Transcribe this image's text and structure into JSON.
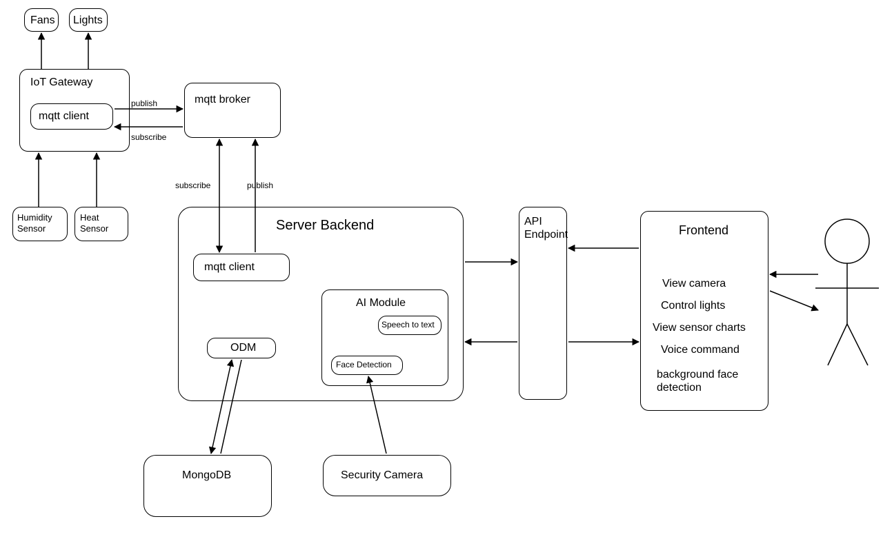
{
  "nodes": {
    "fans": "Fans",
    "lights": "Lights",
    "iot_gateway": "IoT Gateway",
    "mqtt_client_gateway": "mqtt client",
    "mqtt_broker": "mqtt broker",
    "humidity_sensor": "Humidity\nSensor",
    "heat_sensor": "Heat\nSensor",
    "server_backend": "Server Backend",
    "mqtt_client_server": "mqtt client",
    "odm": "ODM",
    "ai_module": "AI Module",
    "speech_to_text": "Speech to text",
    "face_detection": "Face Detection",
    "mongodb": "MongoDB",
    "security_camera": "Security Camera",
    "api_endpoint": "API\nEndpoint",
    "frontend": "Frontend",
    "frontend_items": {
      "view_camera": "View camera",
      "control_lights": "Control lights",
      "view_sensor_charts": "View sensor charts",
      "voice_command": "Voice command",
      "background_face_detection": "background face\ndetection"
    }
  },
  "edges": {
    "publish": "publish",
    "subscribe": "subscribe"
  }
}
